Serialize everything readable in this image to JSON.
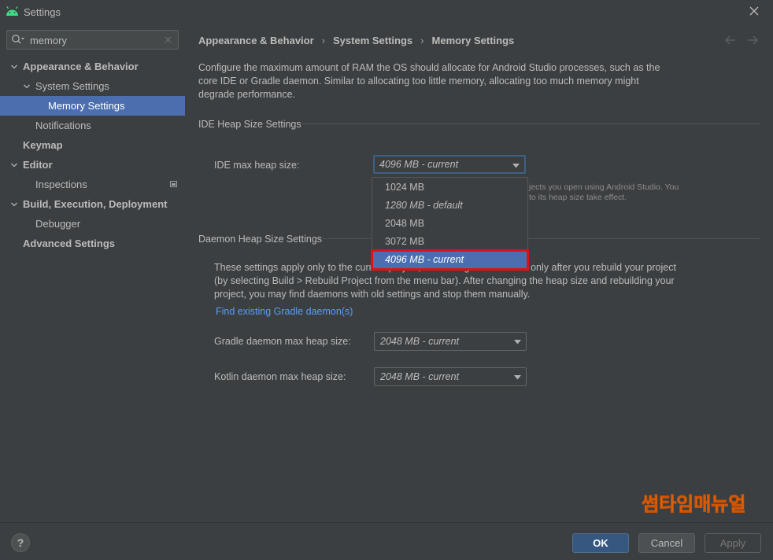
{
  "window": {
    "title": "Settings"
  },
  "sidebar": {
    "search": {
      "value": "memory"
    },
    "items": [
      {
        "label": "Appearance & Behavior",
        "bold": true,
        "expanded": true
      },
      {
        "label": "System Settings",
        "bold": false,
        "expanded": true
      },
      {
        "label": "Memory Settings",
        "selected": true
      },
      {
        "label": "Notifications"
      },
      {
        "label": "Keymap",
        "bold": true
      },
      {
        "label": "Editor",
        "bold": true,
        "expanded": true
      },
      {
        "label": "Inspections"
      },
      {
        "label": "Build, Execution, Deployment",
        "bold": true,
        "expanded": true
      },
      {
        "label": "Debugger"
      },
      {
        "label": "Advanced Settings",
        "bold": true
      }
    ]
  },
  "breadcrumb": [
    "Appearance & Behavior",
    "System Settings",
    "Memory Settings"
  ],
  "main": {
    "description": "Configure the maximum amount of RAM the OS should allocate for Android Studio processes, such as the core IDE or Gradle daemon. Similar to allocating too little memory, allocating too much memory might degrade performance.",
    "ide_section": {
      "title": "IDE Heap Size Settings",
      "label": "IDE max heap size:",
      "value": "4096 MB - current",
      "hint_line1": "jects you open using Android Studio. You",
      "hint_line2": "to its heap size take effect."
    },
    "dropdown": {
      "options": [
        {
          "label": "1024 MB",
          "italic": false
        },
        {
          "label": "1280 MB - default",
          "italic": true
        },
        {
          "label": "2048 MB",
          "italic": false
        },
        {
          "label": "3072 MB",
          "italic": false
        },
        {
          "label": "4096 MB - current",
          "italic": true,
          "selected": true
        }
      ]
    },
    "daemon_section": {
      "title": "Daemon Heap Size Settings",
      "paragraph": "These settings apply only to the current project, and changes take effect only after you rebuild your project (by selecting Build > Rebuild Project from the menu bar). After changing the heap size and rebuilding your project, you may find daemons with old settings and stop them manually.",
      "link": "Find existing Gradle daemon(s)",
      "gradle_label": "Gradle daemon max heap size:",
      "gradle_value": "2048 MB - current",
      "kotlin_label": "Kotlin daemon max heap size:",
      "kotlin_value": "2048 MB - current"
    }
  },
  "footer": {
    "help": "?",
    "ok": "OK",
    "cancel": "Cancel",
    "apply": "Apply"
  },
  "watermark": "썸타임매뉴얼",
  "colors": {
    "background": "#3c3f41",
    "selection": "#4b6eaf",
    "link": "#589df6",
    "highlight_box": "#e0101a",
    "ok_button": "#365880"
  }
}
